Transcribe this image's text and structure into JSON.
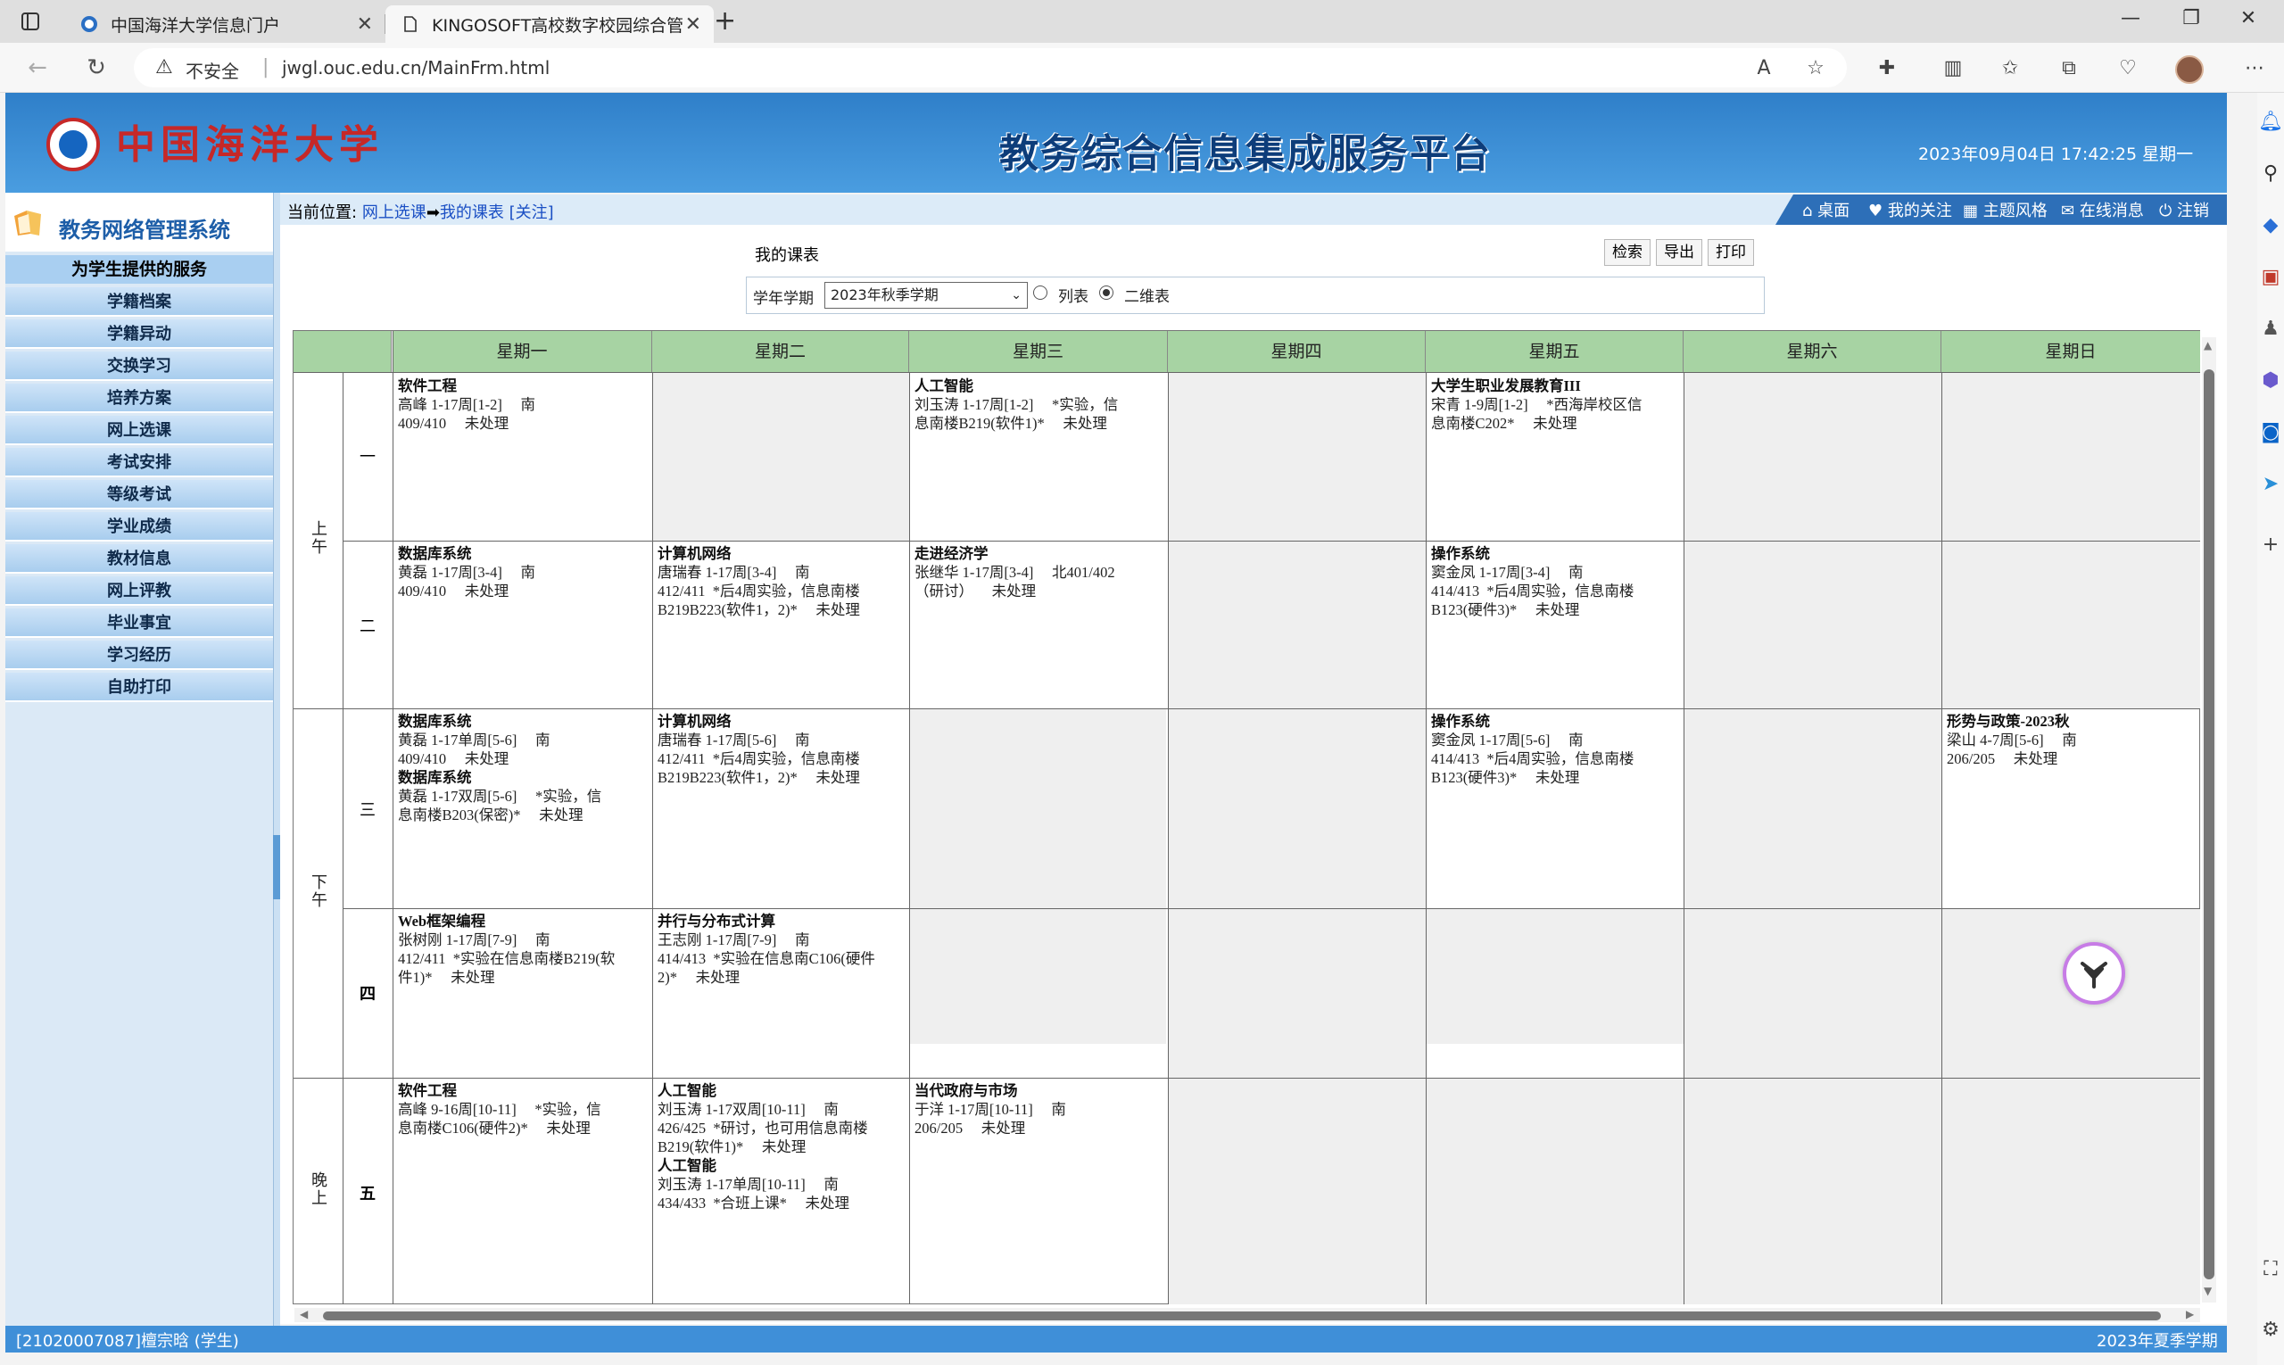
{
  "browser": {
    "tabs": [
      {
        "label": "中国海洋大学信息门户"
      },
      {
        "label": "KINGOSOFT高校数字校园综合管"
      }
    ],
    "security_text": "不安全",
    "url": "jwgl.ouc.edu.cn/MainFrm.html"
  },
  "header": {
    "university": "中国海洋大学",
    "platform_title": "教务综合信息集成服务平台",
    "datetime": "2023年09月04日 17:42:25 星期一"
  },
  "sidebar": {
    "system_title": "教务网络管理系统",
    "service_heading": "为学生提供的服务",
    "items": [
      "学籍档案",
      "学籍异动",
      "交换学习",
      "培养方案",
      "网上选课",
      "考试安排",
      "等级考试",
      "学业成绩",
      "教材信息",
      "网上评教",
      "毕业事宜",
      "学习经历",
      "自助打印"
    ]
  },
  "breadcrumb": {
    "prefix": "当前位置:",
    "link1": "网上选课",
    "arrow": "➡",
    "link2": "我的课表",
    "follow": "[关注]"
  },
  "topnav": [
    "桌面",
    "我的关注",
    "主题风格",
    "在线消息",
    "注销"
  ],
  "form": {
    "title": "我的课表",
    "buttons": [
      "检索",
      "导出",
      "打印"
    ],
    "term_label": "学年学期",
    "term_value": "2023年秋季学期",
    "radio_list": "列表",
    "radio_grid": "二维表"
  },
  "timetable": {
    "days": [
      "星期一",
      "星期二",
      "星期三",
      "星期四",
      "星期五",
      "星期六",
      "星期日"
    ],
    "sessions": [
      "上午",
      "下午",
      "晚上"
    ],
    "periods": [
      "一",
      "二",
      "三",
      "四",
      "五"
    ],
    "cells": {
      "p1": [
        "软件工程\n高峰 1-17周[1-2]     南\n409/410     未处理",
        "",
        "人工智能\n刘玉涛 1-17周[1-2]     *实验，信\n息南楼B219(软件1)*     未处理",
        "",
        "大学生职业发展教育III\n宋青 1-9周[1-2]     *西海岸校区信\n息南楼C202*     未处理",
        "",
        ""
      ],
      "p2": [
        "数据库系统\n黄磊 1-17周[3-4]     南\n409/410     未处理",
        "计算机网络\n唐瑞春 1-17周[3-4]     南\n412/411  *后4周实验，信息南楼\nB219B223(软件1，2)*     未处理",
        "走进经济学\n张继华 1-17周[3-4]     北401/402\n（研讨）     未处理",
        "",
        "操作系统\n窦金凤 1-17周[3-4]     南\n414/413  *后4周实验，信息南楼\nB123(硬件3)*     未处理",
        "",
        ""
      ],
      "p3": [
        "数据库系统\n黄磊 1-17单周[5-6]     南\n409/410     未处理\n数据库系统\n黄磊 1-17双周[5-6]     *实验，信\n息南楼B203(保密)*     未处理",
        "计算机网络\n唐瑞春 1-17周[5-6]     南\n412/411  *后4周实验，信息南楼\nB219B223(软件1，2)*     未处理",
        "",
        "",
        "操作系统\n窦金凤 1-17周[5-6]     南\n414/413  *后4周实验，信息南楼\nB123(硬件3)*     未处理",
        "",
        "形势与政策-2023秋\n梁山 4-7周[5-6]     南\n206/205     未处理"
      ],
      "p4": [
        "Web框架编程\n张树刚 1-17周[7-9]     南\n412/411  *实验在信息南楼B219(软\n件1)*     未处理",
        "并行与分布式计算\n王志刚 1-17周[7-9]     南\n414/413  *实验在信息南C106(硬件\n2)*     未处理",
        "",
        "",
        "",
        "",
        ""
      ],
      "p5": [
        "软件工程\n高峰 9-16周[10-11]     *实验，信\n息南楼C106(硬件2)*     未处理",
        "人工智能\n刘玉涛 1-17双周[10-11]     南\n426/425  *研讨，也可用信息南楼\nB219(软件1)*     未处理\n人工智能\n刘玉涛 1-17单周[10-11]     南\n434/433  *合班上课*     未处理",
        "当代政府与市场\n于洋 1-17周[10-11]     南\n206/205     未处理",
        "",
        "",
        "",
        ""
      ]
    }
  },
  "status": {
    "left": "[21020007087]檀宗晗 (学生)",
    "right": "2023年夏季学期"
  }
}
